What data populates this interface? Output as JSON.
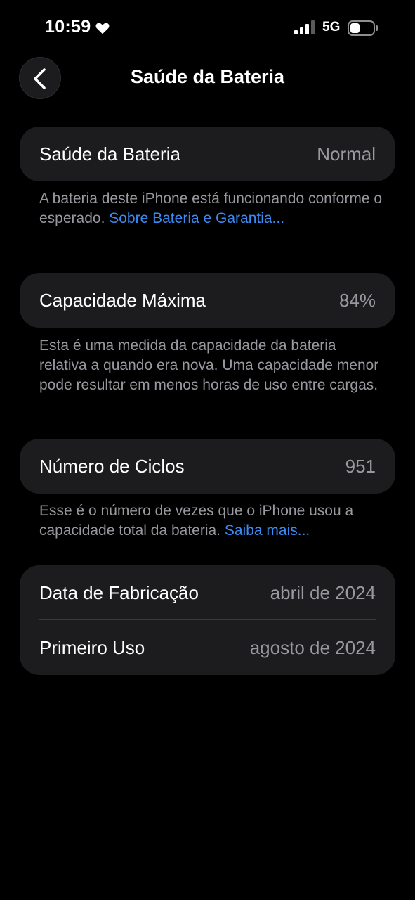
{
  "status_bar": {
    "time": "10:59",
    "network": "5G",
    "icons": [
      "heart-icon",
      "signal-icon",
      "battery-icon"
    ]
  },
  "nav": {
    "back_icon": "chevron-left-icon",
    "title": "Saúde da Bateria"
  },
  "health": {
    "label": "Saúde da Bateria",
    "value": "Normal",
    "footnote_text": "A bateria deste iPhone está funcionando conforme o esperado. ",
    "footnote_link": "Sobre Bateria e Garantia..."
  },
  "capacity": {
    "label": "Capacidade Máxima",
    "value": "84%",
    "footnote_text": "Esta é uma medida da capacidade da bateria relativa a quando era nova. Uma capacidade menor pode resultar em menos horas de uso entre cargas."
  },
  "cycles": {
    "label": "Número de Ciclos",
    "value": "951",
    "footnote_text": "Esse é o número de vezes que o iPhone usou a capacidade total da bateria. ",
    "footnote_link": "Saiba mais..."
  },
  "dates": {
    "manufacture_label": "Data de Fabricação",
    "manufacture_value": "abril de 2024",
    "first_use_label": "Primeiro Uso",
    "first_use_value": "agosto de 2024"
  },
  "colors": {
    "background": "#000000",
    "card": "#1c1c1e",
    "secondary_text": "#98989f",
    "link": "#3b8bf5"
  }
}
